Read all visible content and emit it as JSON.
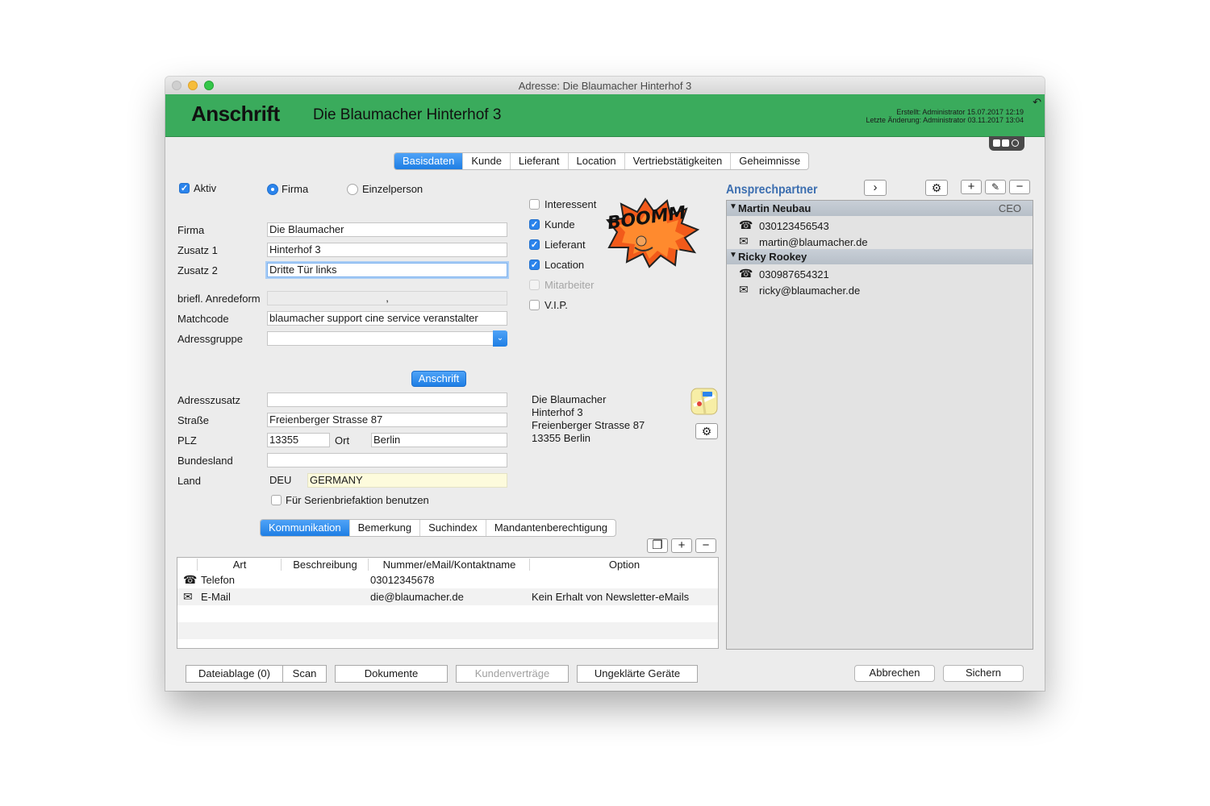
{
  "window": {
    "title": "Adresse: Die Blaumacher Hinterhof 3"
  },
  "header": {
    "heading": "Anschrift",
    "name": "Die Blaumacher Hinterhof 3",
    "created": "Erstellt: Administrator 15.07.2017 12:19",
    "changed": "Letzte Änderung: Administrator 03.11.2017 13:04"
  },
  "tabs": [
    "Basisdaten",
    "Kunde",
    "Lieferant",
    "Location",
    "Vertriebstätigkeiten",
    "Geheimnisse"
  ],
  "active_tab": "Basisdaten",
  "form": {
    "aktiv_label": "Aktiv",
    "firma_radio": "Firma",
    "einzelperson_radio": "Einzelperson",
    "labels": {
      "firma": "Firma",
      "zusatz1": "Zusatz 1",
      "zusatz2": "Zusatz 2",
      "anrede": "briefl. Anredeform",
      "matchcode": "Matchcode",
      "adressgruppe": "Adressgruppe",
      "adresszusatz": "Adresszusatz",
      "strasse": "Straße",
      "plz": "PLZ",
      "ort": "Ort",
      "bundesland": "Bundesland",
      "land": "Land"
    },
    "values": {
      "firma": "Die Blaumacher",
      "zusatz1": "Hinterhof 3",
      "zusatz2": "Dritte Tür links",
      "anrede": ",",
      "matchcode": "blaumacher support cine service veranstalter",
      "adressgruppe": "",
      "adresszusatz": "",
      "strasse": "Freienberger Strasse 87",
      "plz": "13355",
      "ort": "Berlin",
      "bundesland": "",
      "land_code": "DEU",
      "land_name": "GERMANY"
    },
    "anschrift_button": "Anschrift",
    "serienbrief_label": "Für Serienbriefaktion benutzen"
  },
  "roles": [
    {
      "label": "Interessent",
      "checked": false,
      "disabled": false
    },
    {
      "label": "Kunde",
      "checked": true,
      "disabled": false
    },
    {
      "label": "Lieferant",
      "checked": true,
      "disabled": false
    },
    {
      "label": "Location",
      "checked": true,
      "disabled": false
    },
    {
      "label": "Mitarbeiter",
      "checked": false,
      "disabled": true
    },
    {
      "label": "V.I.P.",
      "checked": false,
      "disabled": false
    }
  ],
  "sticker_text": "BOOMM",
  "address_preview": [
    "Die Blaumacher",
    "Hinterhof 3",
    "Freienberger Strasse 87",
    "13355 Berlin"
  ],
  "sub_tabs": [
    "Kommunikation",
    "Bemerkung",
    "Suchindex",
    "Mandantenberechtigung"
  ],
  "active_sub_tab": "Kommunikation",
  "comm_table": {
    "columns": [
      "Art",
      "Beschreibung",
      "Nummer/eMail/Kontaktname",
      "Option"
    ],
    "rows": [
      {
        "icon": "phone-icon",
        "art": "Telefon",
        "beschreibung": "",
        "nummer": "03012345678",
        "option": ""
      },
      {
        "icon": "mail-icon",
        "art": "E-Mail",
        "beschreibung": "",
        "nummer": "die@blaumacher.de",
        "option": "Kein Erhalt von Newsletter-eMails"
      }
    ]
  },
  "contacts": {
    "title": "Ansprechpartner",
    "people": [
      {
        "name": "Martin Neubau",
        "role": "CEO",
        "phone": "030123456543",
        "email": "martin@blaumacher.de"
      },
      {
        "name": "Ricky Rookey",
        "role": "",
        "phone": "030987654321",
        "email": "ricky@blaumacher.de"
      }
    ]
  },
  "footer": {
    "dateiablage": "Dateiablage (0)",
    "scan": "Scan",
    "dokumente": "Dokumente",
    "kundenvertraege": "Kundenverträge",
    "geraete": "Ungeklärte Geräte",
    "abbrechen": "Abbrechen",
    "sichern": "Sichern"
  },
  "colors": {
    "header_green": "#3aab5c",
    "accent_blue": "#1e7ee4",
    "group_header": "#bcc4cd"
  }
}
